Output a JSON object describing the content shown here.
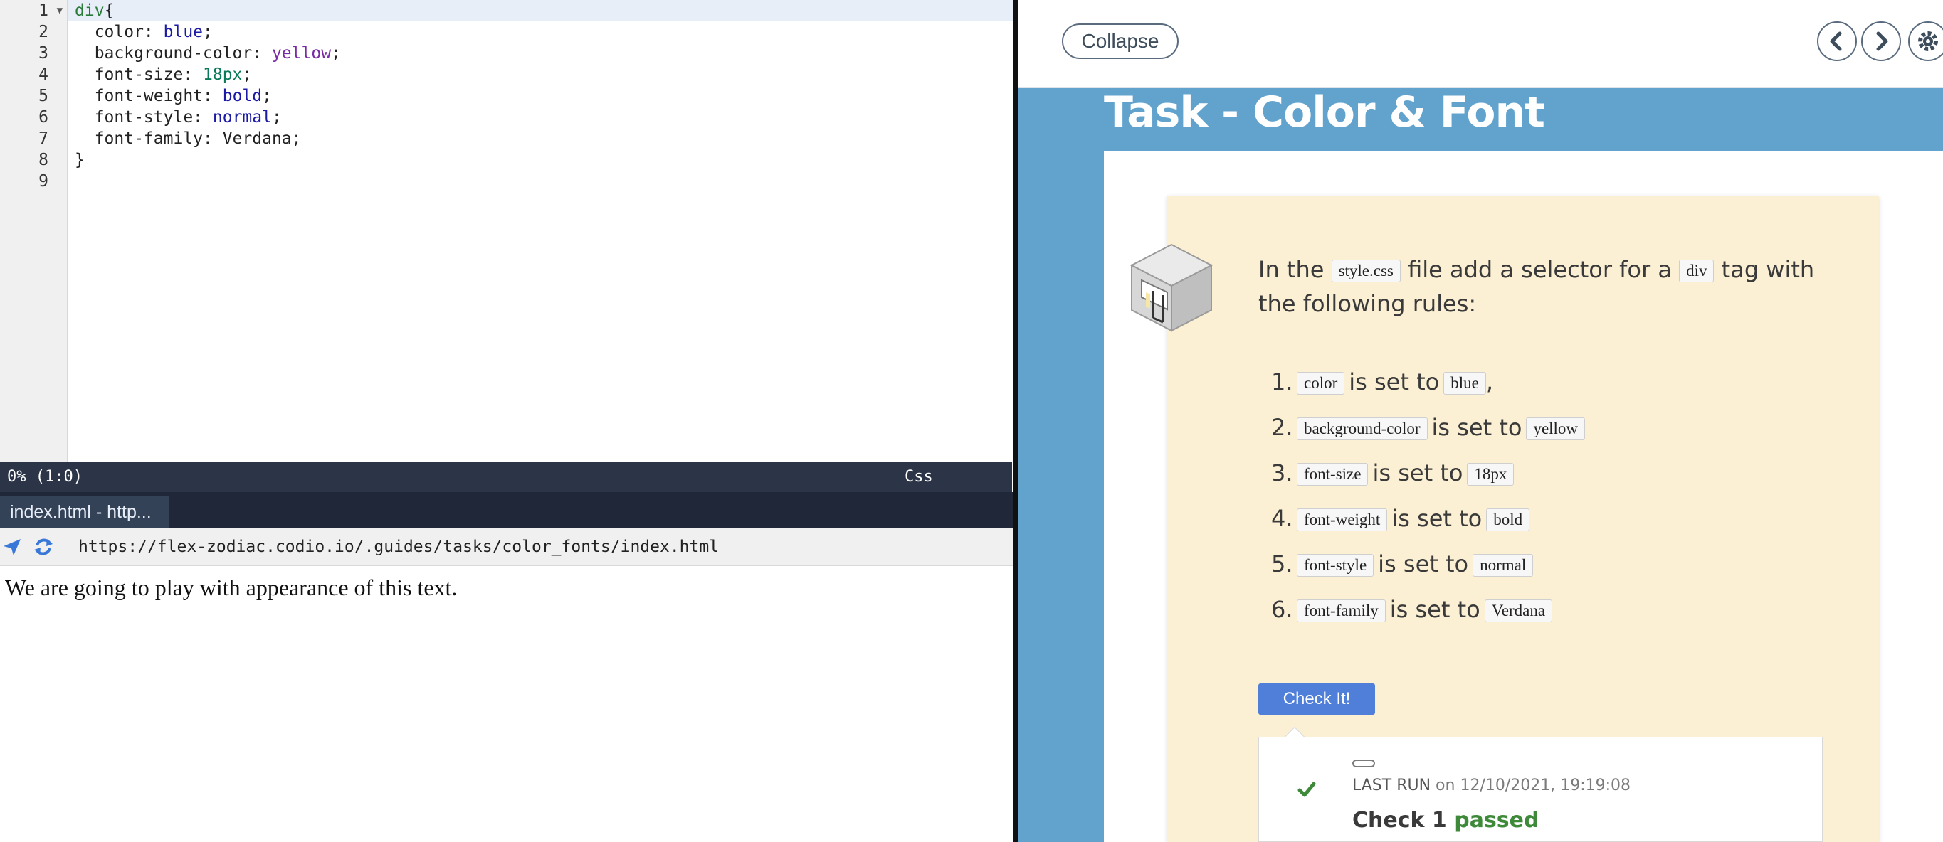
{
  "editor": {
    "line_numbers": [
      "1",
      "2",
      "3",
      "4",
      "5",
      "6",
      "7",
      "8",
      "9"
    ],
    "code": {
      "line1_selector": "div",
      "line1_brace": "{",
      "line2_prop": "  color: ",
      "line2_val": "blue",
      "line3_prop": "  background-color: ",
      "line3_val": "yellow",
      "line4_prop": "  font-size: ",
      "line4_val": "18px",
      "line5_prop": "  font-weight: ",
      "line5_val": "bold",
      "line6_prop": "  font-style: ",
      "line6_val": "normal",
      "line7_prop": "  font-family: ",
      "line7_val": "Verdana",
      "semicolon": ";",
      "line8": "}",
      "line9": ""
    },
    "status": {
      "position": "0%  (1:0)",
      "mode": "Css"
    }
  },
  "preview": {
    "tab_label": "index.html - http...",
    "url": "https://flex-zodiac.codio.io/.guides/tasks/color_fonts/index.html",
    "body_text": "We are going to play with appearance of this text."
  },
  "guide": {
    "collapse_label": "Collapse",
    "title": "Task - Color & Font",
    "intro": {
      "t1": "In the ",
      "file": "style.css",
      "t2": " file add a selector for a ",
      "tag": "div",
      "t3": " tag with the following rules:"
    },
    "rules": [
      {
        "num": "1.",
        "prop": "color",
        "text": "is set to",
        "value": "blue",
        "suffix": ","
      },
      {
        "num": "2.",
        "prop": "background-color",
        "text": "is set to",
        "value": "yellow",
        "suffix": ""
      },
      {
        "num": "3.",
        "prop": "font-size",
        "text": "is set to",
        "value": "18px",
        "suffix": ""
      },
      {
        "num": "4.",
        "prop": "font-weight",
        "text": "is set to",
        "value": "bold",
        "suffix": ""
      },
      {
        "num": "5.",
        "prop": "font-style",
        "text": "is set to",
        "value": "normal",
        "suffix": ""
      },
      {
        "num": "6.",
        "prop": "font-family",
        "text": "is set to",
        "value": "Verdana",
        "suffix": ""
      }
    ],
    "check_button": "Check It!",
    "result": {
      "last_run_label": "LAST RUN",
      "last_run_on": " on 12/10/2021, 19:19:08",
      "check_name": "Check 1 ",
      "status": "passed"
    }
  },
  "colors": {
    "guide_background": "#62a3ce",
    "card_background": "#fbf0d4",
    "check_button": "#4f7fd9",
    "passed": "#3f8a3a",
    "status_bar": "#2b3547"
  },
  "icons": [
    "navigate-icon",
    "refresh-icon",
    "prev-icon",
    "next-icon",
    "gear-icon",
    "task-cube-icon",
    "checkmark-icon"
  ]
}
